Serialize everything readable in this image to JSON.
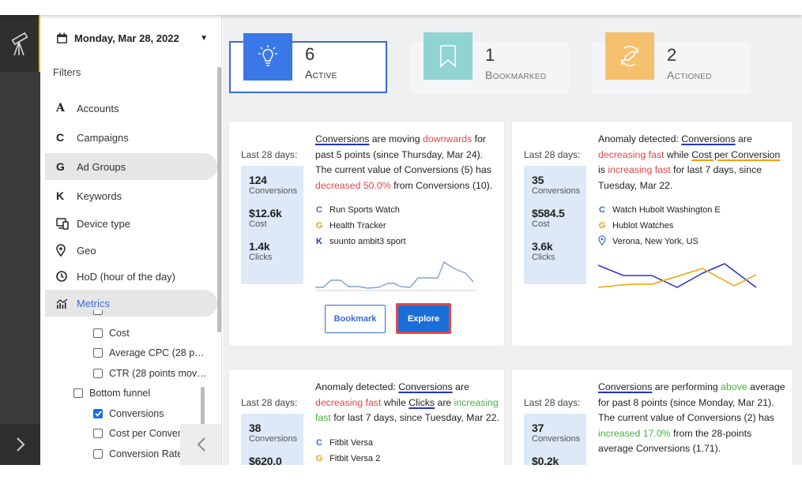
{
  "header": {
    "date": "Monday, Mar 28, 2022"
  },
  "filters": {
    "title": "Filters",
    "items": [
      {
        "icon": "A",
        "label": "Accounts"
      },
      {
        "icon": "C",
        "label": "Campaigns"
      },
      {
        "icon": "G",
        "label": "Ad Groups"
      },
      {
        "icon": "K",
        "label": "Keywords"
      },
      {
        "icon": "device-icon",
        "label": "Device type"
      },
      {
        "icon": "location-pin-icon",
        "label": "Geo"
      },
      {
        "icon": "clock-icon",
        "label": "HoD (hour of the day)"
      },
      {
        "icon": "metrics-icon",
        "label": "Metrics"
      }
    ],
    "metrics_options": [
      {
        "label": "Cost",
        "checked": false
      },
      {
        "label": "Average CPC (28 p…",
        "checked": false
      },
      {
        "label": "CTR (28 points mov…",
        "checked": false
      }
    ],
    "bottom_funnel": {
      "label": "Bottom funnel",
      "checked": false
    },
    "bottom_funnel_options": [
      {
        "label": "Conversions",
        "checked": true
      },
      {
        "label": "Cost per Conversi",
        "checked": false
      },
      {
        "label": "Conversion Rate (",
        "checked": false
      }
    ]
  },
  "tabs": [
    {
      "count": "6",
      "label": "Active",
      "color": "#3b78e7",
      "icon": "lightbulb-icon"
    },
    {
      "count": "1",
      "label": "Bookmarked",
      "color": "#8fd3d3",
      "icon": "bookmark-icon"
    },
    {
      "count": "2",
      "label": "Actioned",
      "color": "#f5c06e",
      "icon": "actioned-icon"
    }
  ],
  "cards": [
    {
      "period": "Last 28 days:",
      "stats": [
        {
          "value": "124",
          "unit": "Conversions"
        },
        {
          "value": "$12.6k",
          "unit": "Cost"
        },
        {
          "value": "1.4k",
          "unit": "Clicks"
        }
      ],
      "text": {
        "p1": "Conversions",
        "p2": " are moving ",
        "p3": "downwards",
        "p4": " for past 5 points (since Thursday, Mar 24). The current value of Conversions (5) has ",
        "p5": "decreased 50.0%",
        "p6": " from Conversions (10)."
      },
      "dims": [
        {
          "icon": "C",
          "label": "Run Sports Watch"
        },
        {
          "icon": "G",
          "label": "Health Tracker"
        },
        {
          "icon": "K",
          "label": "suunto ambit3 sport"
        }
      ],
      "buttons": {
        "bookmark": "Bookmark",
        "explore": "Explore"
      }
    },
    {
      "period": "Last 28 days:",
      "stats": [
        {
          "value": "35",
          "unit": "Conversions"
        },
        {
          "value": "$584.5",
          "unit": "Cost"
        },
        {
          "value": "3.6k",
          "unit": "Clicks"
        }
      ],
      "text": {
        "p1": "Anomaly detected: ",
        "p2": "Conversions",
        "p3": " are ",
        "p4": "decreasing fast",
        "p5": " while ",
        "p6": "Cost per Conversion",
        "p7": " is ",
        "p8": "increasing fast",
        "p9": " for last 7 days, since Tuesday, Mar 22."
      },
      "dims": [
        {
          "icon": "C",
          "label": "Watch Hubolt Washington E"
        },
        {
          "icon": "G",
          "label": "Hublot Watches"
        },
        {
          "icon": "location-pin-icon",
          "label": "Verona, New York, US"
        }
      ]
    },
    {
      "period": "Last 28 days:",
      "stats": [
        {
          "value": "38",
          "unit": "Conversions"
        },
        {
          "value": "$620.0",
          "unit": ""
        }
      ],
      "text": {
        "p1": "Anomaly detected: ",
        "p2": "Conversions",
        "p3": " are ",
        "p4": "decreasing fast",
        "p5": " while ",
        "p6": "Clicks",
        "p7": " are ",
        "p8": "increasing fast",
        "p9": " for last 7 days, since Tuesday, Mar 22."
      },
      "dims": [
        {
          "icon": "C",
          "label": "Fitbit Versa"
        },
        {
          "icon": "G",
          "label": "Fitbit Versa 2"
        }
      ]
    },
    {
      "period": "Last 28 days:",
      "stats": [
        {
          "value": "37",
          "unit": "Conversions"
        },
        {
          "value": "$0.2k",
          "unit": ""
        }
      ],
      "text": {
        "p1": "Conversions",
        "p2": " are performing ",
        "p3": "above",
        "p4": " average for past 8 points (since Monday, Mar 21). The current value of Conversions (2) has ",
        "p5": "increased 17.0%",
        "p6": " from the 28-points average Conversions (1.71)."
      }
    }
  ],
  "colors": {
    "accent": "#3a6bd6",
    "negative": "#e04848",
    "positive": "#48b040",
    "series_a": "#2233cc",
    "series_b": "#f2a000"
  }
}
